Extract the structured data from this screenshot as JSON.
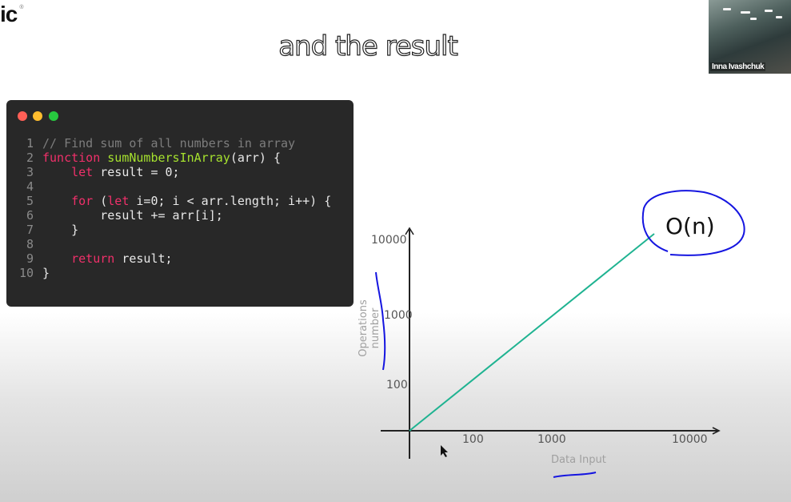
{
  "logo": {
    "text": "ic",
    "mark": "®"
  },
  "slide": {
    "title": "and the result"
  },
  "participant": {
    "name": "Inna Ivashchuk"
  },
  "code_window": {
    "dots": [
      "#ff5f56",
      "#ffbd2e",
      "#27c93f"
    ],
    "lines": [
      {
        "n": "1",
        "tokens": [
          [
            "comment",
            "// Find sum of all numbers in array"
          ]
        ]
      },
      {
        "n": "2",
        "tokens": [
          [
            "kw",
            "function"
          ],
          [
            "plain",
            " "
          ],
          [
            "fn",
            "sumNumbersInArray"
          ],
          [
            "plain",
            "(arr) {"
          ]
        ]
      },
      {
        "n": "3",
        "tokens": [
          [
            "plain",
            "    "
          ],
          [
            "kw",
            "let"
          ],
          [
            "plain",
            " result = 0;"
          ]
        ]
      },
      {
        "n": "4",
        "tokens": []
      },
      {
        "n": "5",
        "tokens": [
          [
            "plain",
            "    "
          ],
          [
            "kw",
            "for"
          ],
          [
            "plain",
            " ("
          ],
          [
            "kw",
            "let"
          ],
          [
            "plain",
            " i=0; i < arr.length; i++) {"
          ]
        ]
      },
      {
        "n": "6",
        "tokens": [
          [
            "plain",
            "        result += arr[i];"
          ]
        ]
      },
      {
        "n": "7",
        "tokens": [
          [
            "plain",
            "    }"
          ]
        ]
      },
      {
        "n": "8",
        "tokens": []
      },
      {
        "n": "9",
        "tokens": [
          [
            "plain",
            "    "
          ],
          [
            "kw",
            "return"
          ],
          [
            "plain",
            " result;"
          ]
        ]
      },
      {
        "n": "10",
        "tokens": [
          [
            "plain",
            "}"
          ]
        ]
      }
    ]
  },
  "chart_data": {
    "type": "line",
    "title": "",
    "annotation": "O(n)",
    "xlabel": "Data Input",
    "ylabel": "Operations number",
    "x_ticks": [
      "100",
      "1000",
      "10000"
    ],
    "y_ticks": [
      "100",
      "1000",
      "10000"
    ],
    "series": [
      {
        "name": "O(n)",
        "color": "#1fb391",
        "x": [
          0,
          10000
        ],
        "y": [
          0,
          10000
        ]
      }
    ],
    "grid": false
  }
}
